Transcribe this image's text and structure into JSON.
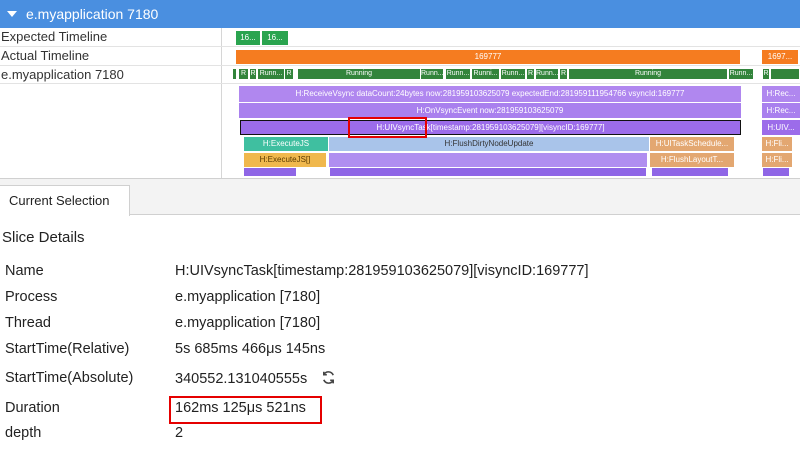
{
  "header": {
    "title": "e.myapplication 7180"
  },
  "tracks": {
    "expected": {
      "label": "Expected Timeline",
      "slices": [
        "16...",
        "16..."
      ]
    },
    "actual": {
      "label": "Actual Timeline",
      "slices": [
        "169777",
        "1697..."
      ]
    },
    "thread": {
      "label": "e.myapplication 7180",
      "states": [
        "R",
        "R",
        "Runn...",
        "R",
        "Running",
        "Runn...",
        "Runn...",
        "Runni...",
        "Runn...",
        "R",
        "Runn...",
        "R",
        "Running",
        "Runn...",
        "R"
      ]
    },
    "slices": {
      "receive_vsync": "H:ReceiveVsync dataCount:24bytes now:281959103625079 expectedEnd:281959111954766 vsyncId:169777",
      "receive_vsync_right": "H:Rec...",
      "on_vsync_event": "H:OnVsyncEvent now:281959103625079",
      "on_vsync_right": "H:Rec...",
      "ui_vsync_task": "H:UIVsyncTask[timestamp:281959103625079][visyncID:169777]",
      "ui_vsync_right": "H:UIV...",
      "execute_js": "H:ExecuteJS",
      "flush_dirty": "H:FlushDirtyNodeUpdate",
      "ui_task_schedule": "H:UITaskSchedule...",
      "fli_right": "H:Fli...",
      "execute_js2": "H:ExecuteJS[]",
      "flush_layout": "H:FlushLayoutT...",
      "fli_right2": "H:Fli..."
    }
  },
  "panel": {
    "tab_label": "Current Selection",
    "section_title": "Slice Details",
    "details": [
      {
        "key": "Name",
        "value": "H:UIVsyncTask[timestamp:281959103625079][visyncID:169777]"
      },
      {
        "key": "Process",
        "value": "e.myapplication [7180]"
      },
      {
        "key": "Thread",
        "value": "e.myapplication [7180]"
      },
      {
        "key": "StartTime(Relative)",
        "value": "5s 685ms 466μs 145ns"
      },
      {
        "key": "StartTime(Absolute)",
        "value": "340552.131040555s"
      },
      {
        "key": "Duration",
        "value": "162ms 125μs 521ns"
      },
      {
        "key": "depth",
        "value": "2"
      }
    ]
  },
  "colors": {
    "header": "#4a8fe0",
    "expected": "#2aa44f",
    "actual": "#f57c20",
    "running": "#32843b",
    "slice_purple": "#b087ef",
    "highlight": "#e50000"
  }
}
